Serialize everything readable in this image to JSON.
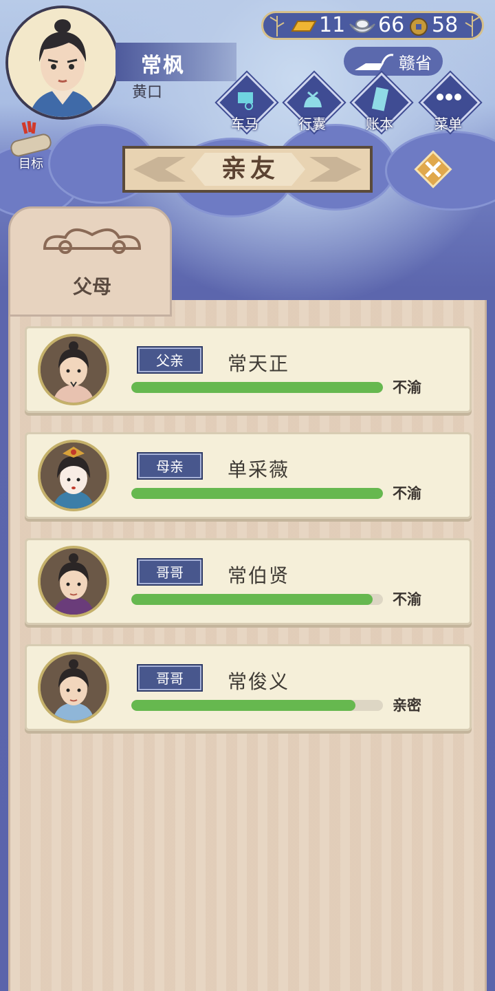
{
  "player": {
    "name": "常枫",
    "title": "黄口"
  },
  "currency": {
    "gold": "11",
    "silver": "66",
    "coin": "58"
  },
  "region": "赣省",
  "nav": {
    "carriage": "车马",
    "luggage": "行囊",
    "ledger": "账本",
    "menu": "菜单"
  },
  "goal_label": "目标",
  "screen_title": "亲友",
  "tab_label": "父母",
  "relatives": [
    {
      "role": "父亲",
      "name": "常天正",
      "status": "不渝",
      "affinity": 1.0
    },
    {
      "role": "母亲",
      "name": "单采薇",
      "status": "不渝",
      "affinity": 1.0
    },
    {
      "role": "哥哥",
      "name": "常伯贤",
      "status": "不渝",
      "affinity": 0.96
    },
    {
      "role": "哥哥",
      "name": "常俊义",
      "status": "亲密",
      "affinity": 0.89
    }
  ],
  "colors": {
    "bar_fill": "#66b84f",
    "tag_bg": "#48578d",
    "panel": "#e6d3bf"
  }
}
